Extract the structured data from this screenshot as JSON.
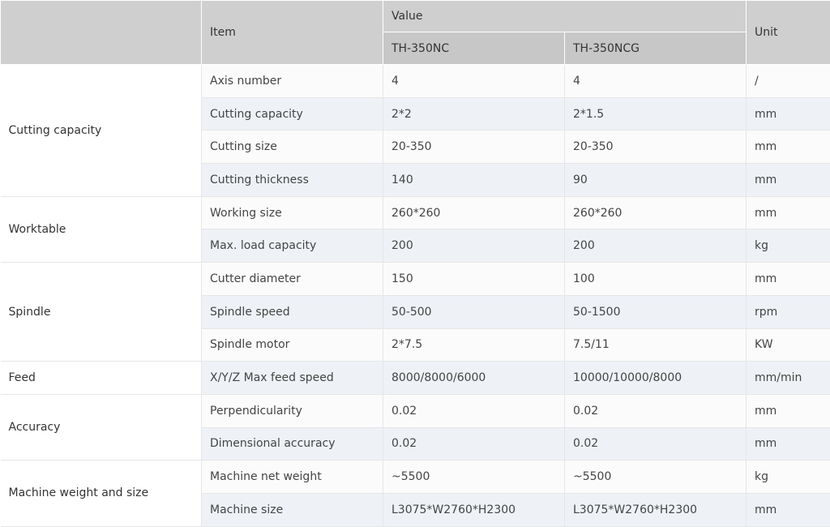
{
  "header": {
    "item": "Item",
    "value": "Value",
    "unit": "Unit",
    "models": [
      "TH-350NC",
      "TH-350NCG"
    ]
  },
  "groups": [
    {
      "name": "Cutting capacity",
      "rows": [
        {
          "item": "Axis number",
          "v1": "4",
          "v2": "4",
          "unit": "/"
        },
        {
          "item": "Cutting capacity",
          "v1": "2*2",
          "v2": "2*1.5",
          "unit": "mm"
        },
        {
          "item": "Cutting size",
          "v1": "20-350",
          "v2": "20-350",
          "unit": "mm"
        },
        {
          "item": "Cutting thickness",
          "v1": "140",
          "v2": "90",
          "unit": "mm"
        }
      ]
    },
    {
      "name": "Worktable",
      "rows": [
        {
          "item": "Working size",
          "v1": "260*260",
          "v2": "260*260",
          "unit": "mm"
        },
        {
          "item": "Max. load capacity",
          "v1": "200",
          "v2": "200",
          "unit": "kg"
        }
      ]
    },
    {
      "name": "Spindle",
      "rows": [
        {
          "item": "Cutter diameter",
          "v1": "150",
          "v2": "100",
          "unit": "mm"
        },
        {
          "item": "Spindle speed",
          "v1": "50-500",
          "v2": "50-1500",
          "unit": "rpm"
        },
        {
          "item": "Spindle motor",
          "v1": "2*7.5",
          "v2": "7.5/11",
          "unit": "KW"
        }
      ]
    },
    {
      "name": "Feed",
      "rows": [
        {
          "item": "X/Y/Z Max feed speed",
          "v1": "8000/8000/6000",
          "v2": "10000/10000/8000",
          "unit": "mm/min"
        }
      ]
    },
    {
      "name": "Accuracy",
      "rows": [
        {
          "item": "Perpendicularity",
          "v1": "0.02",
          "v2": "0.02",
          "unit": "mm"
        },
        {
          "item": "Dimensional accuracy",
          "v1": "0.02",
          "v2": "0.02",
          "unit": "mm"
        }
      ]
    },
    {
      "name": "Machine weight and size",
      "rows": [
        {
          "item": "Machine net weight",
          "v1": "~5500",
          "v2": "~5500",
          "unit": "kg"
        },
        {
          "item": "Machine size",
          "v1": "L3075*W2760*H2300",
          "v2": "L3075*W2760*H2300",
          "unit": "mm"
        }
      ]
    }
  ]
}
